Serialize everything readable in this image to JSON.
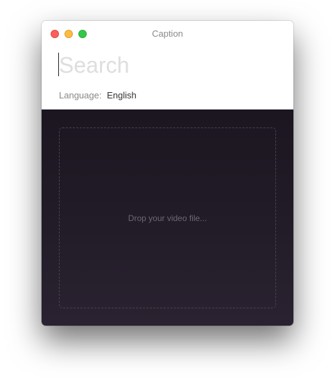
{
  "window": {
    "title": "Caption"
  },
  "search": {
    "placeholder": "Search",
    "value": ""
  },
  "language": {
    "label": "Language:",
    "value": "English"
  },
  "dropzone": {
    "text": "Drop your video file..."
  },
  "colors": {
    "close": "#fc605c",
    "minimize": "#fdbc40",
    "zoom": "#34c84a",
    "drop_background": "#1f1924"
  }
}
